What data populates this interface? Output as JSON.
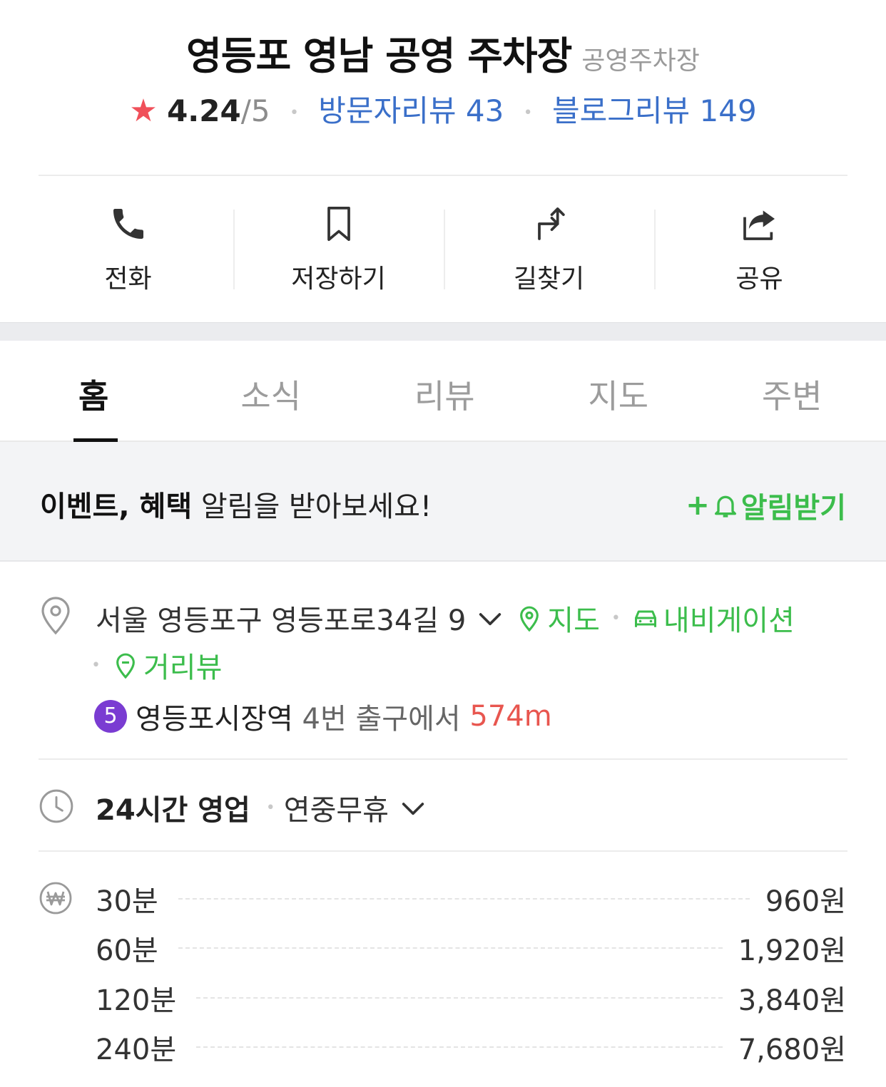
{
  "place": {
    "name": "영등포 영남 공영 주차장",
    "category": "공영주차장",
    "rating": "4.24",
    "rating_max": "/5",
    "visitor_reviews": "방문자리뷰 43",
    "blog_reviews": "블로그리뷰 149"
  },
  "actions": [
    {
      "label": "전화",
      "icon": "phone-icon"
    },
    {
      "label": "저장하기",
      "icon": "bookmark-icon"
    },
    {
      "label": "길찾기",
      "icon": "directions-icon"
    },
    {
      "label": "공유",
      "icon": "share-icon"
    }
  ],
  "tabs": [
    {
      "label": "홈",
      "active": true
    },
    {
      "label": "소식"
    },
    {
      "label": "리뷰"
    },
    {
      "label": "지도"
    },
    {
      "label": "주변"
    }
  ],
  "notice": {
    "bold_part": "이벤트, 혜택",
    "rest": " 알림을 받아보세요!",
    "button_plus": "+",
    "button_label": "알림받기"
  },
  "address": {
    "text": "서울 영등포구 영등포로34길 9",
    "map_link": "지도",
    "navigation_link": "내비게이션",
    "street_view_link": "거리뷰"
  },
  "subway": {
    "line": "5",
    "line_color": "#7a3cd2",
    "station": "영등포시장역",
    "exit": " 4번 출구에서 ",
    "distance": "574m"
  },
  "hours": {
    "status": "24시간 영업",
    "holiday": "연중무휴"
  },
  "prices": [
    {
      "duration": "30분",
      "price": "960원"
    },
    {
      "duration": "60분",
      "price": "1,920원"
    },
    {
      "duration": "120분",
      "price": "3,840원"
    },
    {
      "duration": "240분",
      "price": "7,680원"
    }
  ],
  "colors": {
    "accent_green": "#3cbd4c",
    "link_blue": "#3a6fc9",
    "star_red": "#f0505a",
    "distance_red": "#e8564f"
  }
}
